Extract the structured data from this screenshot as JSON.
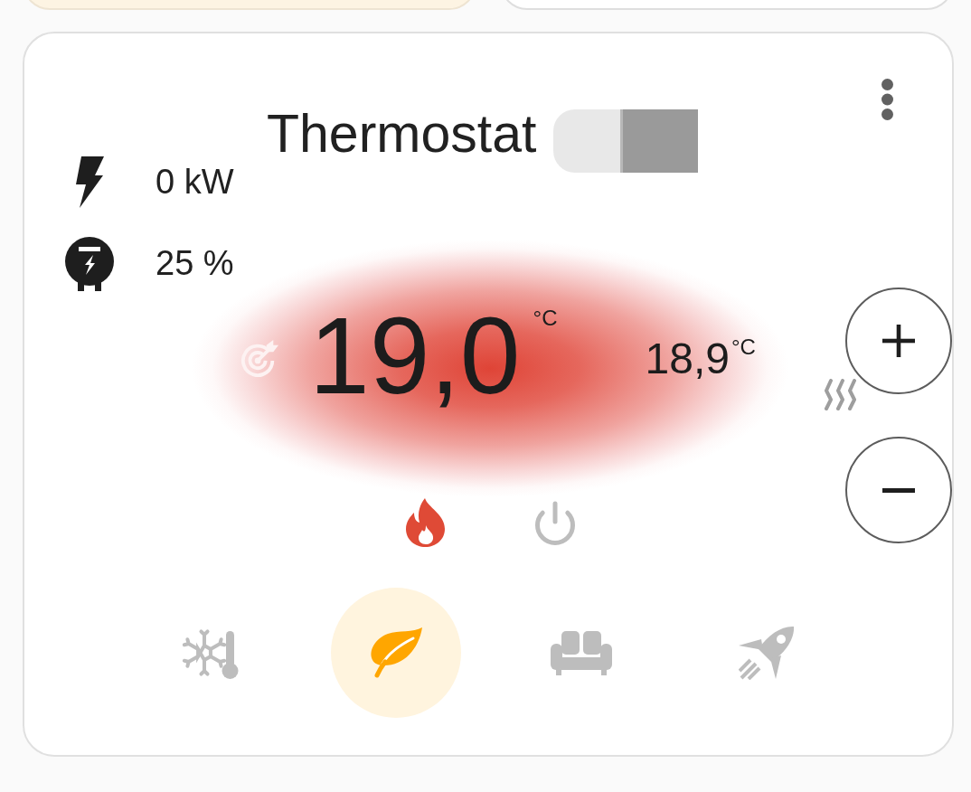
{
  "top_cards": [
    {
      "active": true
    },
    {
      "active": false
    }
  ],
  "card": {
    "title": "Thermostat",
    "sensors": [
      {
        "kind": "power",
        "value": "0 kW"
      },
      {
        "kind": "valve",
        "value": "25 %"
      }
    ],
    "heating": true,
    "target_temperature": {
      "value": "19,0",
      "unit": "°C"
    },
    "current_temperature": {
      "value": "18,9",
      "unit": "°C"
    },
    "hvac_modes": [
      {
        "kind": "heat",
        "selected": true
      },
      {
        "kind": "off",
        "selected": false
      }
    ],
    "presets": [
      {
        "kind": "frost",
        "selected": false
      },
      {
        "kind": "eco",
        "selected": true
      },
      {
        "kind": "comfort",
        "selected": false
      },
      {
        "kind": "boost",
        "selected": false
      }
    ]
  }
}
